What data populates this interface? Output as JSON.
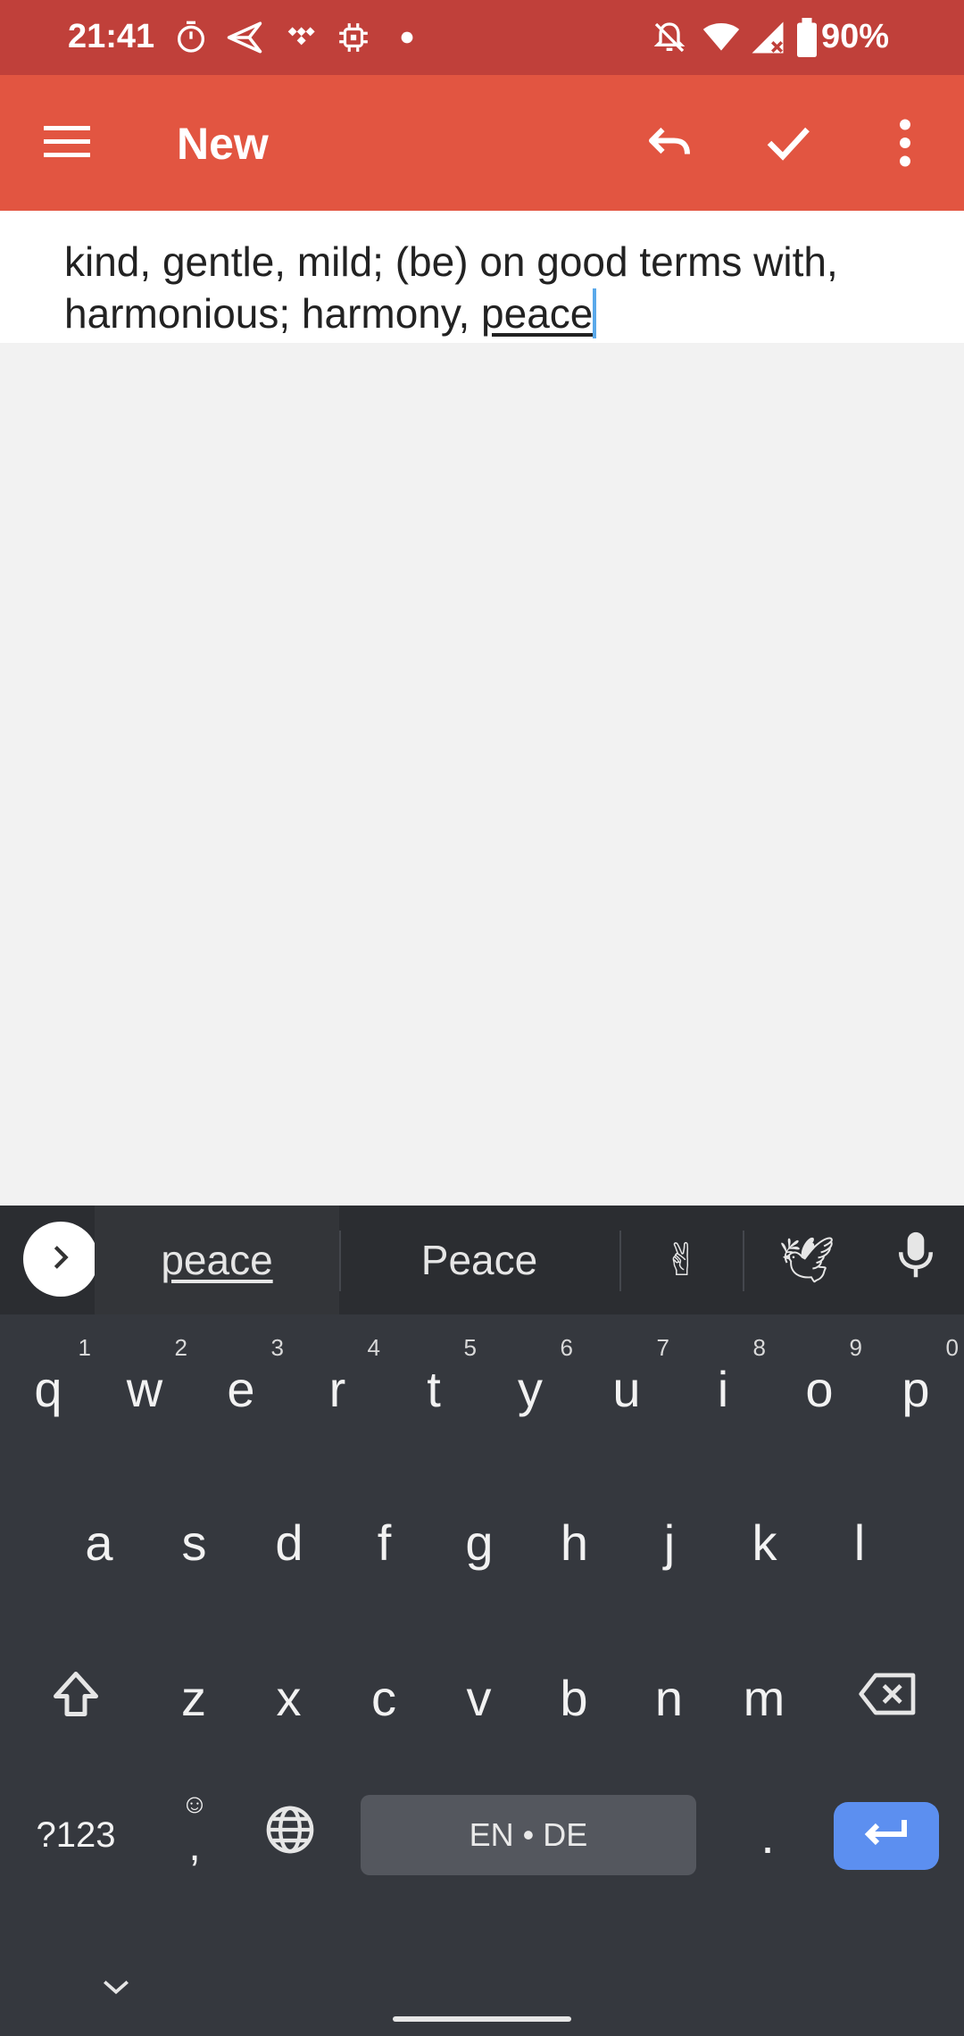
{
  "status_bar": {
    "time": "21:41",
    "battery": "90%",
    "icons_left": [
      "timer-icon",
      "send-icon",
      "tidal-icon",
      "chip-icon",
      "dot-icon"
    ],
    "icons_right": [
      "notifications-off-icon",
      "wifi-icon",
      "signal-icon",
      "battery-icon"
    ]
  },
  "app_bar": {
    "title": "New",
    "icons": [
      "menu-icon",
      "undo-icon",
      "check-icon",
      "more-vert-icon"
    ],
    "color": "#e25541"
  },
  "editor": {
    "text_main": "kind, gentle, mild; (be) on good terms with, harmonious; harmony, ",
    "text_current_word": "peace"
  },
  "keyboard": {
    "suggestions": [
      "peace",
      "Peace",
      "✌",
      "🕊"
    ],
    "row1": [
      {
        "key": "q",
        "hint": "1"
      },
      {
        "key": "w",
        "hint": "2"
      },
      {
        "key": "e",
        "hint": "3"
      },
      {
        "key": "r",
        "hint": "4"
      },
      {
        "key": "t",
        "hint": "5"
      },
      {
        "key": "y",
        "hint": "6"
      },
      {
        "key": "u",
        "hint": "7"
      },
      {
        "key": "i",
        "hint": "8"
      },
      {
        "key": "o",
        "hint": "9"
      },
      {
        "key": "p",
        "hint": "0"
      }
    ],
    "row2": [
      "a",
      "s",
      "d",
      "f",
      "g",
      "h",
      "j",
      "k",
      "l"
    ],
    "row3": [
      "z",
      "x",
      "c",
      "v",
      "b",
      "n",
      "m"
    ],
    "symbols_label": "?123",
    "comma_label": ",",
    "space_label": "EN • DE",
    "period_label": ".",
    "enter_color": "#5c8ff0"
  }
}
